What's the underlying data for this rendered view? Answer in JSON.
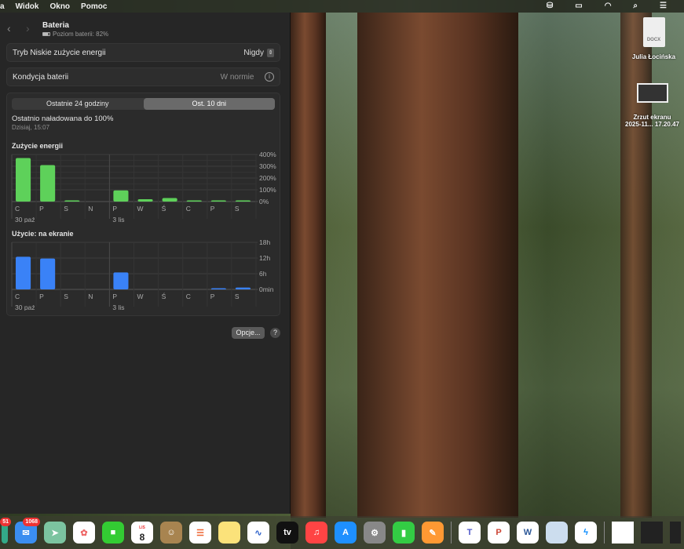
{
  "menubar": {
    "items": [
      "a",
      "Widok",
      "Okno",
      "Pomoc"
    ]
  },
  "window": {
    "title": "Bateria",
    "subtitle": "Poziom baterii: 82%",
    "battery_level_percent": 82
  },
  "low_power": {
    "label": "Tryb Niskie zużycie energii",
    "value": "Nigdy"
  },
  "health": {
    "label": "Kondycja baterii",
    "value": "W normie"
  },
  "tabs": [
    {
      "label": "Ostatnie 24 godziny",
      "selected": false
    },
    {
      "label": "Ost. 10 dni",
      "selected": true
    }
  ],
  "last_charged": {
    "title": "Ostatnio naładowana do 100%",
    "time": "Dzisiaj, 15:07"
  },
  "chart_data": [
    {
      "type": "bar",
      "title": "Zużycie energii",
      "categories": [
        "C",
        "P",
        "S",
        "N",
        "P",
        "W",
        "Ś",
        "C",
        "P",
        "S"
      ],
      "date_labels": [
        "30 paź",
        "3 lis"
      ],
      "values": [
        370,
        310,
        8,
        0,
        95,
        20,
        30,
        10,
        8,
        3
      ],
      "yticks": [
        "400%",
        "300%",
        "200%",
        "100%",
        "0%"
      ],
      "ylim": [
        0,
        400
      ],
      "color": "#5ed15a"
    },
    {
      "type": "bar",
      "title": "Użycie: na ekranie",
      "categories": [
        "C",
        "P",
        "S",
        "N",
        "P",
        "W",
        "Ś",
        "C",
        "P",
        "S"
      ],
      "date_labels": [
        "30 paź",
        "3 lis"
      ],
      "values": [
        12.5,
        11.8,
        0,
        0,
        6.5,
        0,
        0,
        0,
        0.2,
        0.7
      ],
      "yticks": [
        "18h",
        "12h",
        "6h",
        "0min"
      ],
      "ylim": [
        0,
        18
      ],
      "color": "#3a82f7"
    }
  ],
  "buttons": {
    "options": "Opcje...",
    "help": "?"
  },
  "desktop": {
    "file1": "Julia Łocińska",
    "file1_type": "DOCX",
    "file2_line1": "Zrzut ekranu",
    "file2_line2": "2025-11... 17.20.47"
  },
  "dock": {
    "mail_badge": "1068",
    "other_badge": "51",
    "calendar_month": "LIS",
    "calendar_day": "8",
    "tv": "tv"
  }
}
